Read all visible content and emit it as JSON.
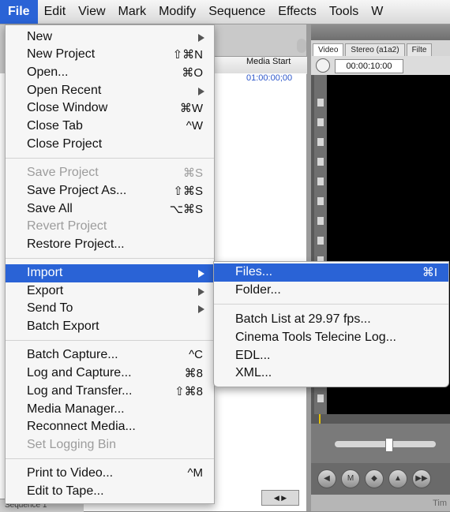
{
  "menubar": {
    "items": [
      "File",
      "Edit",
      "View",
      "Mark",
      "Modify",
      "Sequence",
      "Effects",
      "Tools",
      "W"
    ]
  },
  "background": {
    "browser": {
      "media_start": "Media Start",
      "timecode": "01:00:00;00"
    },
    "viewer": {
      "tabs": [
        "Video",
        "Stereo (a1a2)",
        "Filte"
      ],
      "timecode": "00:00:10:00",
      "time_label": "Tim",
      "transport_buttons": [
        "◀",
        "M",
        "◆",
        "▲",
        "▶▶"
      ],
      "nav_arrows": "◀ ▶"
    },
    "sequence_tab": "Sequence 1"
  },
  "file_menu": {
    "items": [
      {
        "label": "New",
        "shortcut": "",
        "submenu": true,
        "disabled": false
      },
      {
        "label": "New Project",
        "shortcut": "⇧⌘N",
        "submenu": false,
        "disabled": false
      },
      {
        "label": "Open...",
        "shortcut": "⌘O",
        "submenu": false,
        "disabled": false
      },
      {
        "label": "Open Recent",
        "shortcut": "",
        "submenu": true,
        "disabled": false
      },
      {
        "label": "Close Window",
        "shortcut": "⌘W",
        "submenu": false,
        "disabled": false
      },
      {
        "label": "Close Tab",
        "shortcut": "^W",
        "submenu": false,
        "disabled": false
      },
      {
        "label": "Close Project",
        "shortcut": "",
        "submenu": false,
        "disabled": false
      },
      {
        "label": "Save Project",
        "shortcut": "⌘S",
        "submenu": false,
        "disabled": true
      },
      {
        "label": "Save Project As...",
        "shortcut": "⇧⌘S",
        "submenu": false,
        "disabled": false
      },
      {
        "label": "Save All",
        "shortcut": "⌥⌘S",
        "submenu": false,
        "disabled": false
      },
      {
        "label": "Revert Project",
        "shortcut": "",
        "submenu": false,
        "disabled": true
      },
      {
        "label": "Restore Project...",
        "shortcut": "",
        "submenu": false,
        "disabled": false
      },
      {
        "label": "Import",
        "shortcut": "",
        "submenu": true,
        "disabled": false,
        "highlighted": true
      },
      {
        "label": "Export",
        "shortcut": "",
        "submenu": true,
        "disabled": false
      },
      {
        "label": "Send To",
        "shortcut": "",
        "submenu": true,
        "disabled": false
      },
      {
        "label": "Batch Export",
        "shortcut": "",
        "submenu": false,
        "disabled": false
      },
      {
        "label": "Batch Capture...",
        "shortcut": "^C",
        "submenu": false,
        "disabled": false
      },
      {
        "label": "Log and Capture...",
        "shortcut": "⌘8",
        "submenu": false,
        "disabled": false
      },
      {
        "label": "Log and Transfer...",
        "shortcut": "⇧⌘8",
        "submenu": false,
        "disabled": false
      },
      {
        "label": "Media Manager...",
        "shortcut": "",
        "submenu": false,
        "disabled": false
      },
      {
        "label": "Reconnect Media...",
        "shortcut": "",
        "submenu": false,
        "disabled": false
      },
      {
        "label": "Set Logging Bin",
        "shortcut": "",
        "submenu": false,
        "disabled": true
      },
      {
        "label": "Print to Video...",
        "shortcut": "^M",
        "submenu": false,
        "disabled": false
      },
      {
        "label": "Edit to Tape...",
        "shortcut": "",
        "submenu": false,
        "disabled": false
      }
    ]
  },
  "import_menu": {
    "items": [
      {
        "label": "Files...",
        "shortcut": "⌘I",
        "highlighted": true
      },
      {
        "label": "Folder...",
        "shortcut": ""
      },
      {
        "label": "Batch List at 29.97 fps...",
        "shortcut": ""
      },
      {
        "label": "Cinema Tools Telecine Log...",
        "shortcut": ""
      },
      {
        "label": "EDL...",
        "shortcut": ""
      },
      {
        "label": "XML...",
        "shortcut": ""
      }
    ]
  },
  "colors": {
    "highlight": "#2a63d6",
    "disabled_text": "#9c9c9c"
  }
}
